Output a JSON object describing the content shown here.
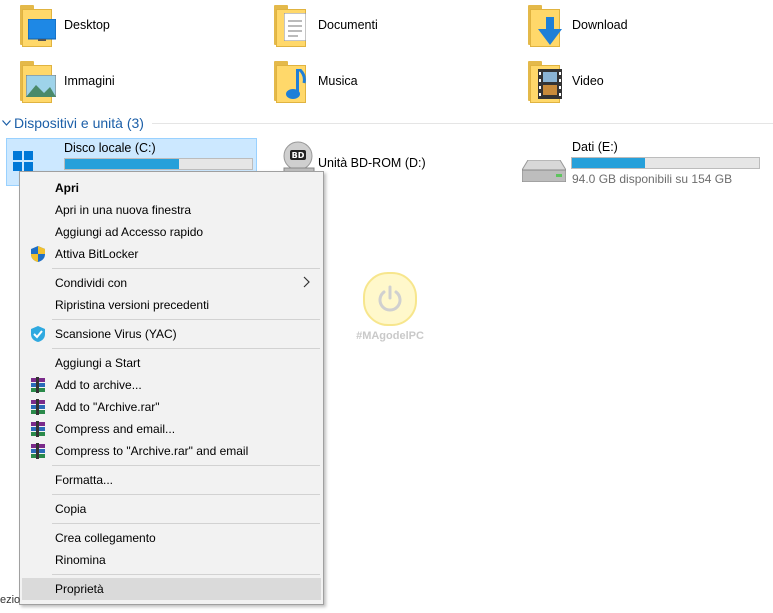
{
  "folders": [
    {
      "label": "Desktop"
    },
    {
      "label": "Documenti"
    },
    {
      "label": "Download"
    },
    {
      "label": "Immagini"
    },
    {
      "label": "Musica"
    },
    {
      "label": "Video"
    }
  ],
  "section": {
    "title": "Dispositivi e unità (3)"
  },
  "drives": [
    {
      "name": "Disco locale (C:)",
      "used_fraction": 0.61
    },
    {
      "name": "Unità BD-ROM (D:)"
    },
    {
      "name": "Dati (E:)",
      "used_fraction": 0.39,
      "free": "94.0 GB disponibili su 154 GB"
    }
  ],
  "watermark": {
    "text": "#MAgodelPC"
  },
  "context_menu": {
    "items": [
      {
        "label": "Apri"
      },
      {
        "label": "Apri in una nuova finestra"
      },
      {
        "label": "Aggiungi ad Accesso rapido"
      },
      {
        "label": "Attiva BitLocker",
        "icon": "shield-icon"
      },
      {
        "label": "Condividi con"
      },
      {
        "label": "Ripristina versioni precedenti"
      },
      {
        "label": "Scansione Virus (YAC)",
        "icon": "antivirus-icon"
      },
      {
        "label": "Aggiungi a Start"
      },
      {
        "label": "Add to archive...",
        "icon": "winrar-icon"
      },
      {
        "label": "Add to \"Archive.rar\"",
        "icon": "winrar-icon"
      },
      {
        "label": "Compress and email...",
        "icon": "winrar-icon"
      },
      {
        "label": "Compress to \"Archive.rar\" and email",
        "icon": "winrar-icon"
      },
      {
        "label": "Formatta..."
      },
      {
        "label": "Copia"
      },
      {
        "label": "Crea collegamento"
      },
      {
        "label": "Rinomina"
      },
      {
        "label": "Proprietà"
      }
    ]
  },
  "status_bar": {
    "text": "ezio"
  },
  "colors": {
    "accent": "#26a0da",
    "section_title": "#1c5fa8",
    "selection": "#cce8ff",
    "menu_bg": "#f2f2f2",
    "menu_hover": "#dadada"
  }
}
